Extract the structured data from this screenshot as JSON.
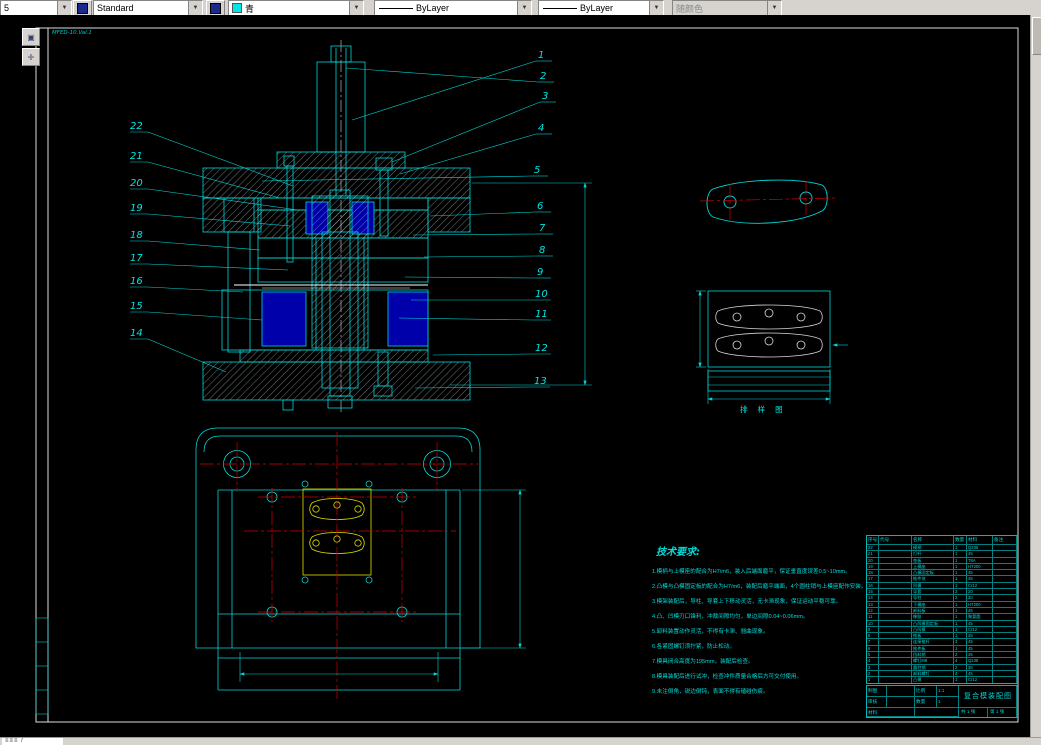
{
  "toolbar": {
    "dim_style": "5",
    "text_style": "Standard",
    "color": "青",
    "linetype": "ByLayer",
    "lineweight": "ByLayer",
    "plot_style": "随颜色"
  },
  "canvas": {
    "sheet_note": "MFED-10.Val.1",
    "callouts_right": [
      "1",
      "2",
      "3",
      "4",
      "5",
      "6",
      "7",
      "8",
      "9",
      "10",
      "11",
      "12",
      "13"
    ],
    "callouts_left": [
      "22",
      "21",
      "20",
      "19",
      "18",
      "17",
      "16",
      "15",
      "14"
    ],
    "strip_label": "排 样 图",
    "tech_req_title": "技术要求:",
    "tech_req_items": [
      "1.模柄与上模座的配合为H7/m6，装入后端面磨平，保证垂直度误差0.5~10mm。",
      "2.凸模与凸模固定板的配合为H7/m6，装配后磨平端面，4个圆柱销与上模座配作安装。",
      "3.模架装配后，导柱、导套上下移动灵活，无卡滞现象，保证运动平稳可靠。",
      "4.凸、凹模刃口锋利，冲裁间隙均匀，单边间隙0.04~0.06mm。",
      "5.卸料装置动作灵活，不得有卡滞、翘曲现象。",
      "6.各紧固螺钉须拧紧，防止松动。",
      "7.模具闭合高度为195mm，装配后检查。",
      "8.模具装配后进行试冲，检查冲件质量合格后方可交付使用。",
      "9.未注倒角，锐边倒钝，表面不得有磕碰伤痕。"
    ]
  },
  "bom": {
    "headers": [
      "序号",
      "代号",
      "名称",
      "数量",
      "材料",
      "备注"
    ],
    "rows": [
      [
        "22",
        "",
        "模柄",
        "1",
        "Q235",
        ""
      ],
      [
        "21",
        "",
        "打杆",
        "1",
        "45",
        ""
      ],
      [
        "20",
        "",
        "垫板",
        "1",
        "T8A",
        ""
      ],
      [
        "19",
        "",
        "上模座",
        "1",
        "HT200",
        ""
      ],
      [
        "18",
        "",
        "凸模固定板",
        "1",
        "45",
        ""
      ],
      [
        "17",
        "",
        "推件块",
        "1",
        "45",
        ""
      ],
      [
        "16",
        "",
        "凹模",
        "1",
        "Cr12",
        ""
      ],
      [
        "15",
        "",
        "导套",
        "2",
        "20",
        ""
      ],
      [
        "14",
        "",
        "导柱",
        "2",
        "20",
        ""
      ],
      [
        "13",
        "",
        "下模座",
        "1",
        "HT200",
        ""
      ],
      [
        "12",
        "",
        "卸料板",
        "1",
        "45",
        ""
      ],
      [
        "11",
        "",
        "橡胶",
        "1",
        "聚氨酯",
        ""
      ],
      [
        "10",
        "",
        "凸凹模固定板",
        "1",
        "45",
        ""
      ],
      [
        "9",
        "",
        "凸凹模",
        "1",
        "Cr12",
        ""
      ],
      [
        "8",
        "",
        "推板",
        "1",
        "45",
        ""
      ],
      [
        "7",
        "",
        "连接推杆",
        "3",
        "45",
        ""
      ],
      [
        "6",
        "",
        "推件板",
        "1",
        "45",
        ""
      ],
      [
        "5",
        "",
        "挡料销",
        "2",
        "45",
        ""
      ],
      [
        "4",
        "",
        "螺钉M8",
        "4",
        "Q235",
        ""
      ],
      [
        "3",
        "",
        "圆柱销",
        "2",
        "35",
        ""
      ],
      [
        "2",
        "",
        "卸料螺钉",
        "4",
        "45",
        ""
      ],
      [
        "1",
        "",
        "凸模",
        "1",
        "Cr12",
        ""
      ]
    ]
  },
  "title_block": {
    "name": "复合模装配图",
    "drawn_label": "制图",
    "checked_label": "审核",
    "scale_label": "比例",
    "scale": "1:1",
    "qty_label": "数量",
    "qty": "1",
    "material_label": "材料",
    "sheets": "共 1 张",
    "page": "第 1 张"
  },
  "status": {
    "marks": "≡≡≡ /"
  }
}
